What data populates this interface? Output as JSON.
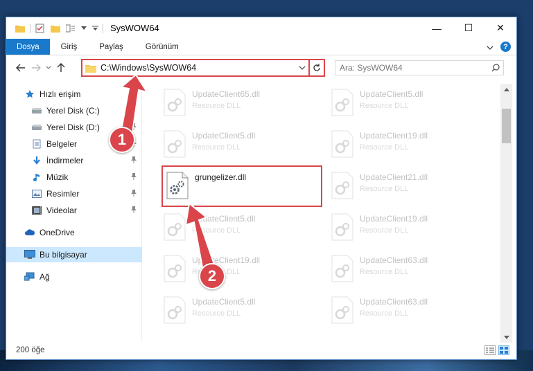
{
  "window": {
    "title": "SysWOW64",
    "controls": {
      "minimize": "—",
      "maximize": "☐",
      "close": "✕"
    }
  },
  "ribbon": {
    "tabs": [
      {
        "label": "Dosya",
        "active": true
      },
      {
        "label": "Giriş"
      },
      {
        "label": "Paylaş"
      },
      {
        "label": "Görünüm"
      }
    ],
    "help": "?"
  },
  "navigation": {
    "address": "C:\\Windows\\SysWOW64",
    "search_placeholder": "Ara: SysWOW64"
  },
  "sidebar": {
    "items": [
      {
        "label": "Hızlı erişim",
        "icon": "star-icon",
        "pinned": false
      },
      {
        "label": "Yerel Disk (C:)",
        "icon": "drive-icon",
        "pinned": true
      },
      {
        "label": "Yerel Disk (D:)",
        "icon": "drive-icon",
        "pinned": true
      },
      {
        "label": "Belgeler",
        "icon": "documents-icon",
        "pinned": true
      },
      {
        "label": "İndirmeler",
        "icon": "download-icon",
        "pinned": true
      },
      {
        "label": "Müzik",
        "icon": "music-icon",
        "pinned": true
      },
      {
        "label": "Resimler",
        "icon": "pictures-icon",
        "pinned": true
      },
      {
        "label": "Videolar",
        "icon": "video-icon",
        "pinned": true
      },
      {
        "label": "OneDrive",
        "icon": "cloud-icon",
        "pinned": false
      },
      {
        "label": "Bu bilgisayar",
        "icon": "computer-icon",
        "pinned": false,
        "selected": true
      },
      {
        "label": "Ağ",
        "icon": "network-icon",
        "pinned": false
      }
    ]
  },
  "files": [
    {
      "name": "UpdateClient65.dll",
      "type": "Resource DLL",
      "faded": true
    },
    {
      "name": "UpdateClient5.dll",
      "type": "Resource DLL",
      "faded": true
    },
    {
      "name": "UpdateClient5.dll",
      "type": "Resource DLL",
      "faded": true
    },
    {
      "name": "UpdateClient19.dll",
      "type": "Resource DLL",
      "faded": true
    },
    {
      "name": "grungelizer.dll",
      "type": "",
      "faded": false
    },
    {
      "name": "UpdateClient21.dll",
      "type": "Resource DLL",
      "faded": true
    },
    {
      "name": "UpdateClient5.dll",
      "type": "Resource DLL",
      "faded": true
    },
    {
      "name": "UpdateClient19.dll",
      "type": "Resource DLL",
      "faded": true
    },
    {
      "name": "UpdateClient19.dll",
      "type": "Resource DLL",
      "faded": true
    },
    {
      "name": "UpdateClient63.dll",
      "type": "Resource DLL",
      "faded": true
    },
    {
      "name": "UpdateClient5.dll",
      "type": "Resource DLL",
      "faded": true
    },
    {
      "name": "UpdateClient63.dll",
      "type": "Resource DLL",
      "faded": true
    }
  ],
  "status": {
    "count": "200 öğe"
  },
  "annotations": {
    "step1": "1",
    "step2": "2"
  },
  "colors": {
    "accent": "#1979ca",
    "highlight": "#d9454b",
    "selected": "#cce8ff"
  }
}
